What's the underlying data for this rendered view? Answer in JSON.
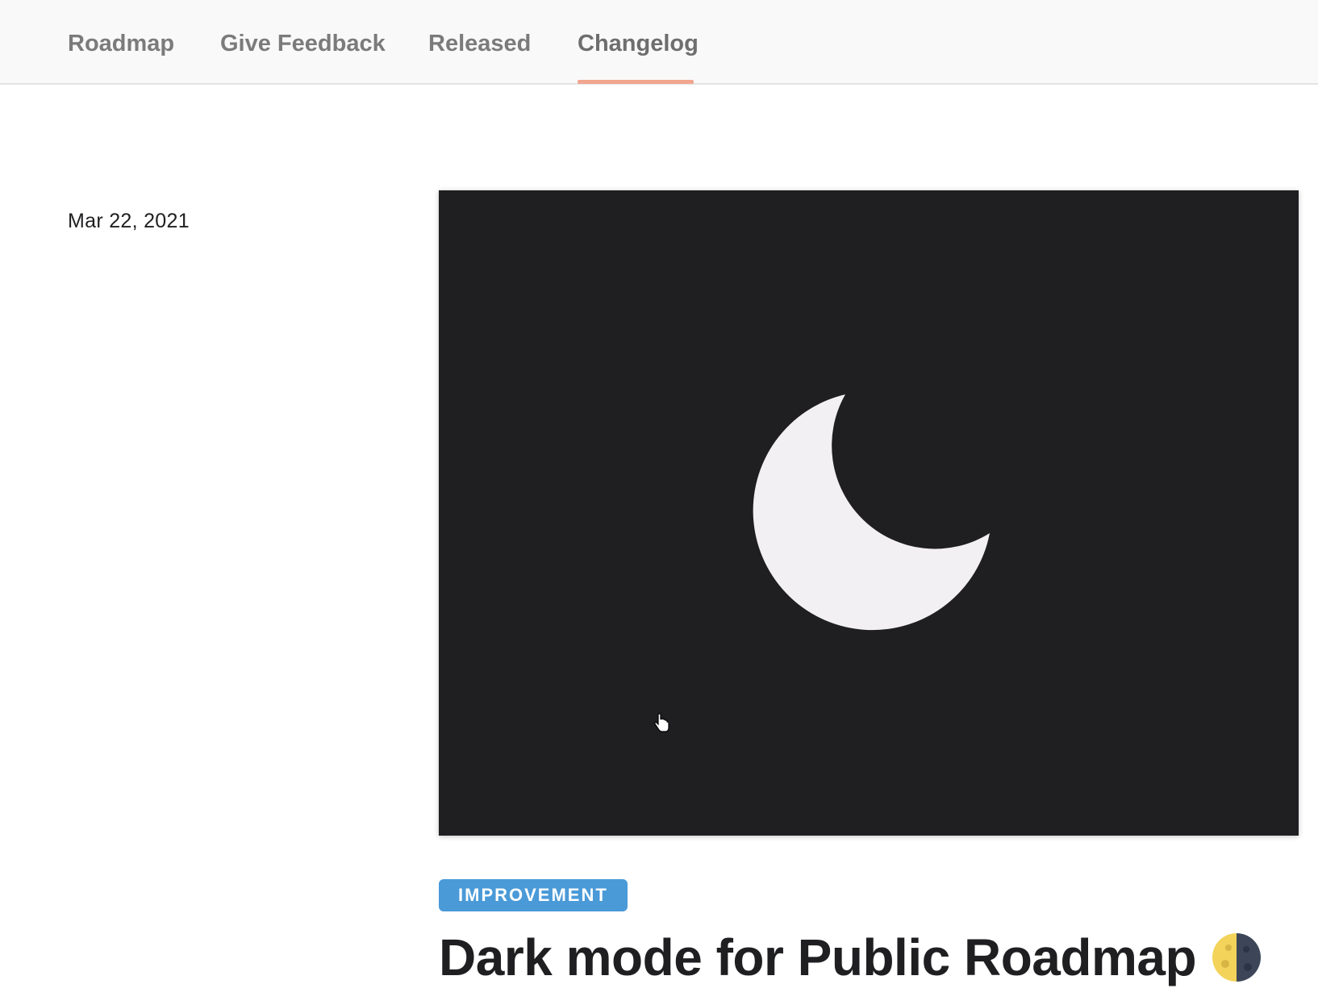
{
  "nav": {
    "tabs": [
      {
        "label": "Roadmap",
        "active": false
      },
      {
        "label": "Give Feedback",
        "active": false
      },
      {
        "label": "Released",
        "active": false
      },
      {
        "label": "Changelog",
        "active": true
      }
    ],
    "active_underline_color": "#f2a58f"
  },
  "post": {
    "date": "Mar 22, 2021",
    "media": {
      "background_color": "#1f1e21",
      "icon": "moon-icon",
      "icon_color": "#f2f0f3"
    },
    "badge": {
      "label": "IMPROVEMENT",
      "color": "#4a9ad8"
    },
    "title": "Dark mode for Public Roadmap",
    "title_emoji": "first-quarter-moon-icon"
  }
}
